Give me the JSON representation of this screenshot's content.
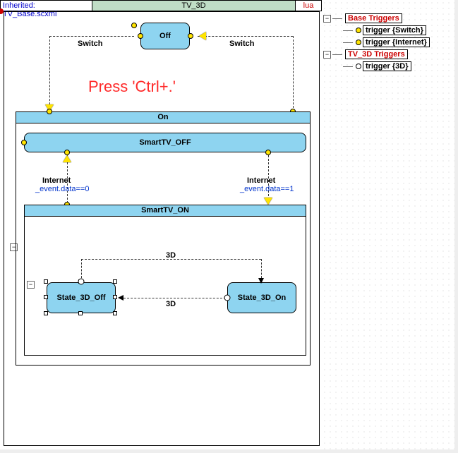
{
  "header": {
    "inherited": "Inherited: TV_Base.scxml",
    "title": "TV_3D",
    "lang": "lua"
  },
  "overlay_text": "Press 'Ctrl+.'",
  "states": {
    "off": "Off",
    "on": "On",
    "smarttv_off": "SmartTV_OFF",
    "smarttv_on": "SmartTV_ON",
    "s3d_off": "State_3D_Off",
    "s3d_on": "State_3D_On"
  },
  "transitions": {
    "switch_l": "Switch",
    "switch_r": "Switch",
    "internet_l": "Internet",
    "internet_l_cond": "_event.data==0",
    "internet_r": "Internet",
    "internet_r_cond": "_event.data==1",
    "d3_top": "3D",
    "d3_mid": "3D"
  },
  "triggers": {
    "group1": "Base Triggers",
    "t1": "trigger {Switch}",
    "t2": "trigger {Internet}",
    "group2": "TV_3D Triggers",
    "t3": "trigger {3D}"
  },
  "chart_data": {
    "type": "statechart",
    "root": "TV_3D",
    "inherited_from": "TV_Base.scxml",
    "script_lang": "lua",
    "states": [
      {
        "id": "Off",
        "parent": "TV_3D"
      },
      {
        "id": "On",
        "parent": "TV_3D",
        "composite": true
      },
      {
        "id": "SmartTV_OFF",
        "parent": "On"
      },
      {
        "id": "SmartTV_ON",
        "parent": "On",
        "composite": true
      },
      {
        "id": "State_3D_Off",
        "parent": "SmartTV_ON",
        "selected": true
      },
      {
        "id": "State_3D_On",
        "parent": "SmartTV_ON"
      }
    ],
    "transitions": [
      {
        "from": "Off",
        "to": "On",
        "event": "Switch"
      },
      {
        "from": "On",
        "to": "Off",
        "event": "Switch"
      },
      {
        "from": "SmartTV_OFF",
        "to": "SmartTV_ON",
        "event": "Internet",
        "cond": "_event.data==1"
      },
      {
        "from": "SmartTV_ON",
        "to": "SmartTV_OFF",
        "event": "Internet",
        "cond": "_event.data==0"
      },
      {
        "from": "State_3D_Off",
        "to": "State_3D_On",
        "event": "3D"
      },
      {
        "from": "State_3D_On",
        "to": "State_3D_Off",
        "event": "3D"
      }
    ],
    "trigger_tree": [
      {
        "label": "Base Triggers",
        "children": [
          "trigger {Switch}",
          "trigger {Internet}"
        ]
      },
      {
        "label": "TV_3D Triggers",
        "children": [
          "trigger {3D}"
        ]
      }
    ]
  }
}
